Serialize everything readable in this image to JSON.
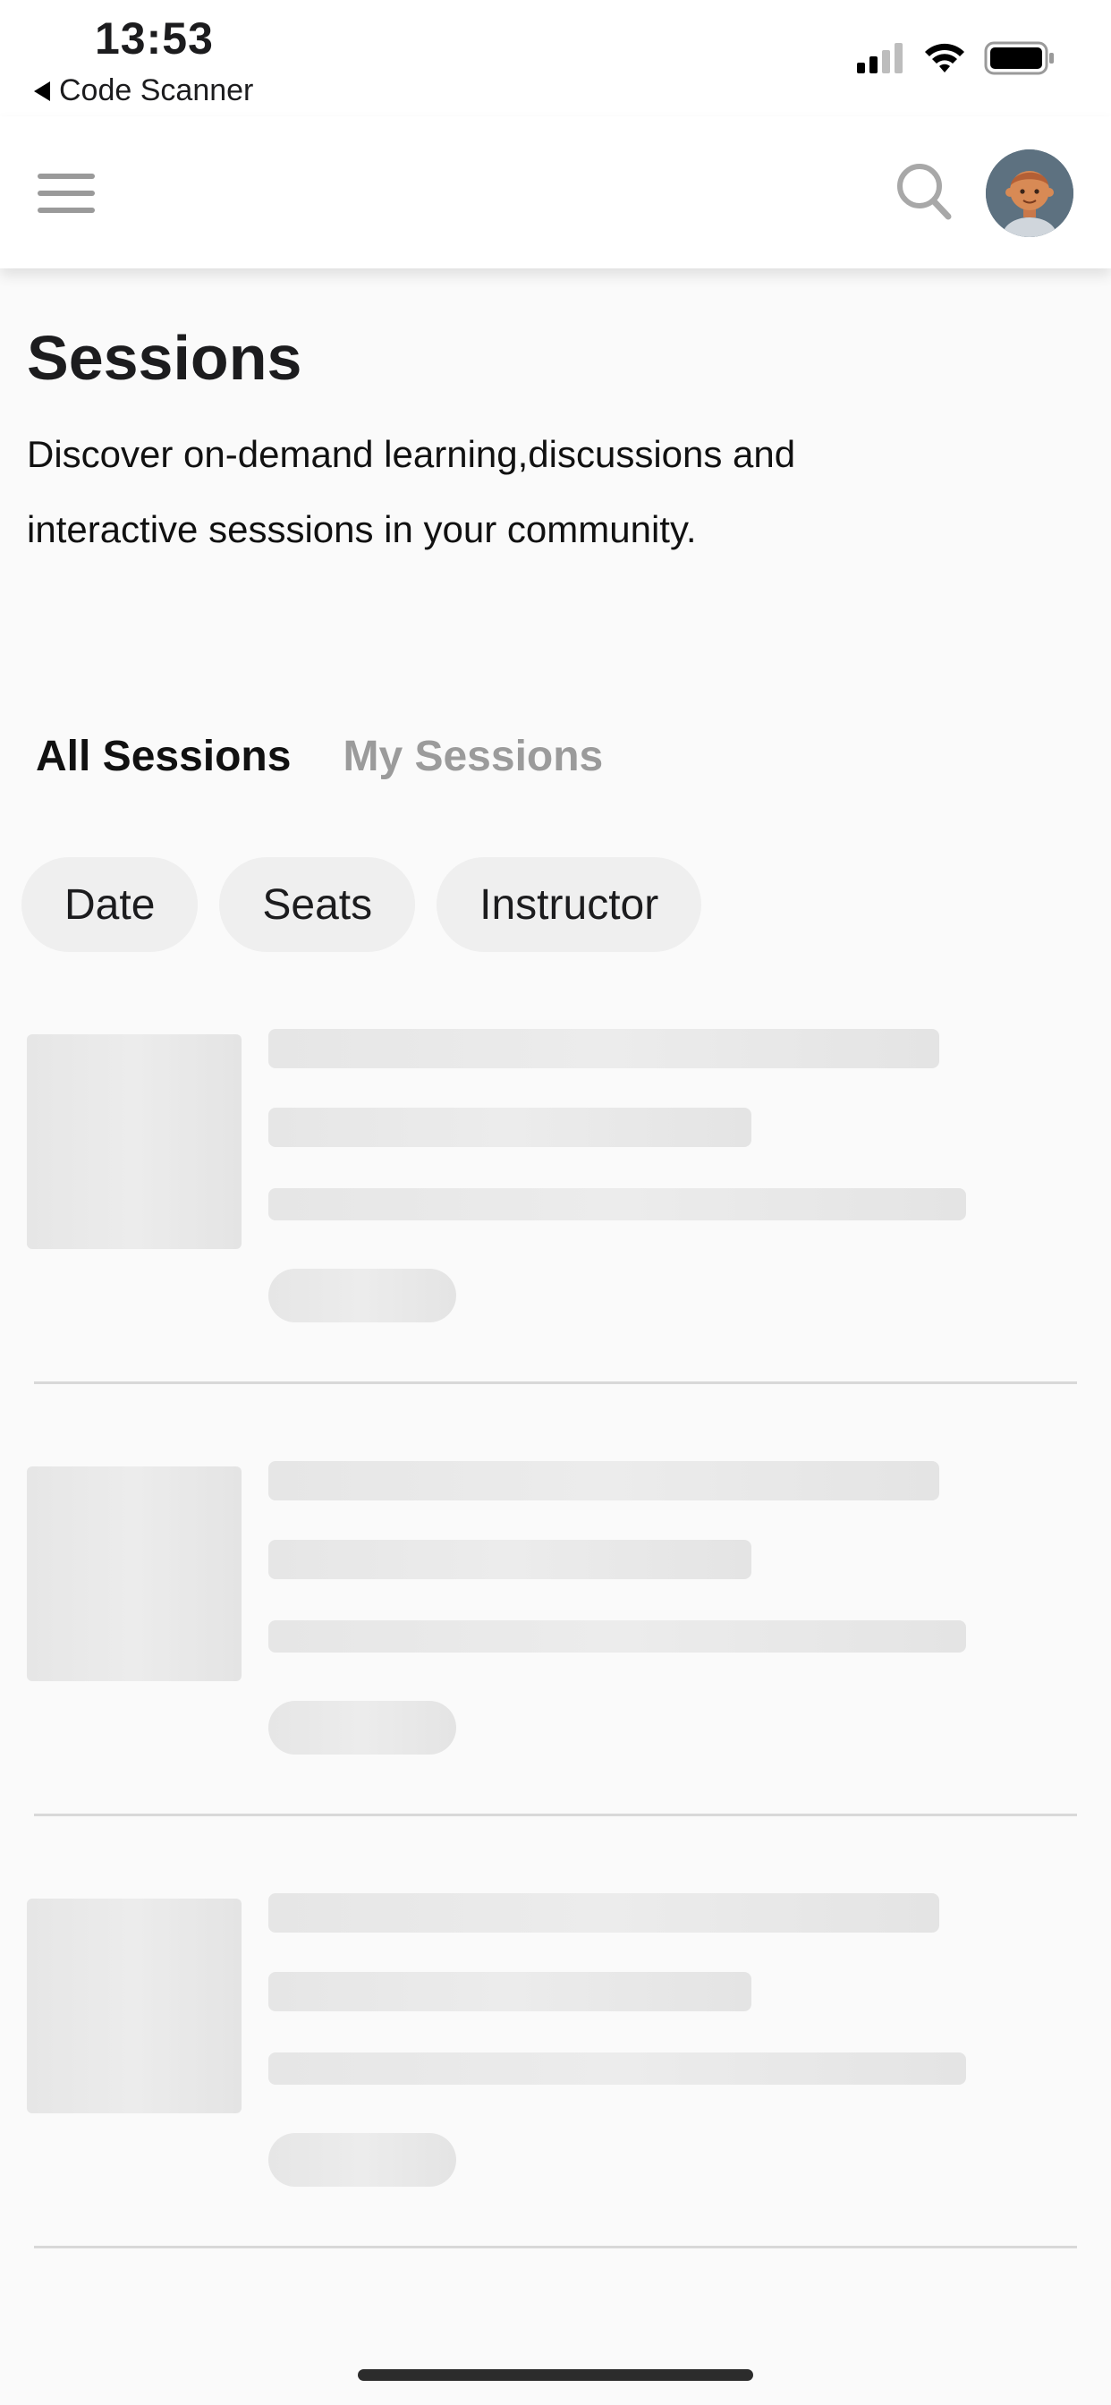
{
  "status_bar": {
    "time": "13:53",
    "back_label": "Code Scanner",
    "icons": [
      "signal-icon",
      "wifi-icon",
      "battery-icon"
    ]
  },
  "header": {
    "menu_icon": "hamburger-menu-icon",
    "search_icon": "search-icon",
    "avatar_icon": "user-avatar"
  },
  "page": {
    "title": "Sessions",
    "description": "Discover on-demand learning,discussions and interactive sesssions in your community."
  },
  "tabs": [
    {
      "label": "All Sessions",
      "active": true
    },
    {
      "label": "My Sessions",
      "active": false
    }
  ],
  "filters": [
    {
      "label": "Date"
    },
    {
      "label": "Seats"
    },
    {
      "label": "Instructor"
    }
  ],
  "colors": {
    "background": "#fafafa",
    "skeleton": "#e6e6e6",
    "chip": "#efefef",
    "inactive_tab": "#9b9b9b"
  }
}
